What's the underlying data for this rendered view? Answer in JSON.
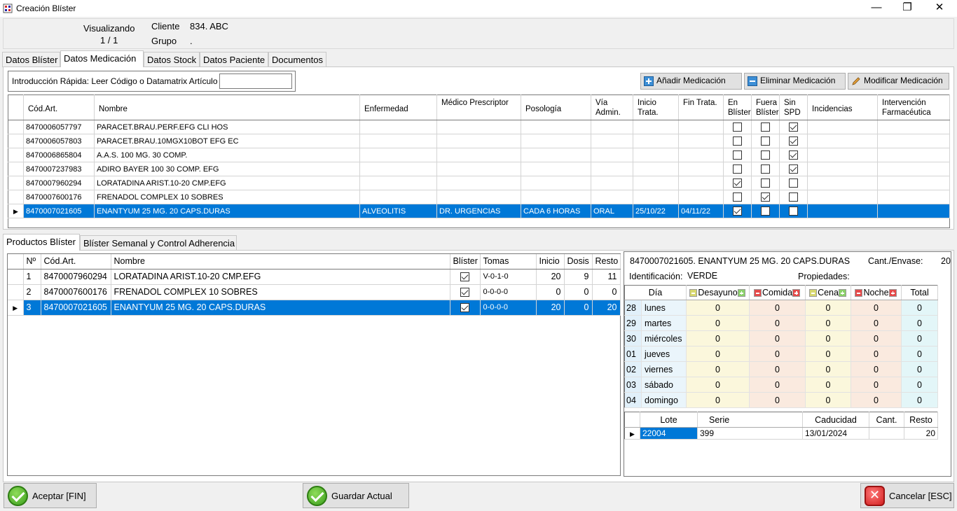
{
  "window": {
    "title": "Creación Blíster"
  },
  "header": {
    "visualizando_label": "Visualizando",
    "visualizando_value": "1 / 1",
    "cliente_label": "Cliente",
    "cliente_value": "834. ABC",
    "grupo_label": "Grupo",
    "grupo_value": "."
  },
  "tabs": [
    "Datos Blíster",
    "Datos Medicación",
    "Datos Stock",
    "Datos Paciente",
    "Documentos"
  ],
  "quick": {
    "label": "Introducción Rápida: Leer Código o Datamatrix Artículo",
    "value": ""
  },
  "buttons": {
    "add": "Añadir Medicación",
    "delete": "Eliminar Medicación",
    "modify": "Modificar Medicación"
  },
  "medgrid": {
    "columns": [
      "Cód.Art.",
      "Nombre",
      "Enfermedad",
      "Médico Prescriptor",
      "Posología",
      "Vía Admin.",
      "Inicio Trata.",
      "Fin Trata.",
      "En Blíster",
      "Fuera Blíster",
      "Sin SPD",
      "Incidencias",
      "Intervención Farmacéutica"
    ],
    "rows": [
      {
        "cod": "8470006057797",
        "nombre": "PARACET.BRAU.PERF.EFG CLI HOS",
        "enf": "",
        "med": "",
        "pos": "",
        "via": "",
        "ini": "",
        "fin": "",
        "en": false,
        "fuera": false,
        "sin": true
      },
      {
        "cod": "8470006057803",
        "nombre": "PARACET.BRAU.10MGX10BOT EFG EC",
        "enf": "",
        "med": "",
        "pos": "",
        "via": "",
        "ini": "",
        "fin": "",
        "en": false,
        "fuera": false,
        "sin": true
      },
      {
        "cod": "8470006865804",
        "nombre": "A.A.S. 100 MG. 30 COMP.",
        "enf": "",
        "med": "",
        "pos": "",
        "via": "",
        "ini": "",
        "fin": "",
        "en": false,
        "fuera": false,
        "sin": true
      },
      {
        "cod": "8470007237983",
        "nombre": "ADIRO BAYER 100 30 COMP. EFG",
        "enf": "",
        "med": "",
        "pos": "",
        "via": "",
        "ini": "",
        "fin": "",
        "en": false,
        "fuera": false,
        "sin": true
      },
      {
        "cod": "8470007960294",
        "nombre": "LORATADINA ARIST.10-20 CMP.EFG",
        "enf": "",
        "med": "",
        "pos": "",
        "via": "",
        "ini": "",
        "fin": "",
        "en": true,
        "fuera": false,
        "sin": false
      },
      {
        "cod": "8470007600176",
        "nombre": "FRENADOL COMPLEX 10 SOBRES",
        "enf": "",
        "med": "",
        "pos": "",
        "via": "",
        "ini": "",
        "fin": "",
        "en": false,
        "fuera": true,
        "sin": false
      },
      {
        "cod": "8470007021605",
        "nombre": "ENANTYUM  25 MG. 20 CAPS.DURAS",
        "enf": "ALVEOLITIS",
        "med": "DR. URGENCIAS",
        "pos": "CADA 6 HORAS",
        "via": "ORAL",
        "ini": "25/10/22",
        "fin": "04/11/22",
        "en": true,
        "fuera": false,
        "sin": false
      }
    ]
  },
  "bottom_tabs": [
    "Productos Blíster",
    "Blíster Semanal y Control Adherencia"
  ],
  "prodgrid": {
    "columns": [
      "Nº",
      "Cód.Art.",
      "Nombre",
      "Blíster",
      "Tomas",
      "Inicio",
      "Dosis",
      "Resto"
    ],
    "rows": [
      {
        "n": "1",
        "cod": "8470007960294",
        "nombre": "LORATADINA ARIST.10-20 CMP.EFG",
        "blister": true,
        "tomas": "V-0-1-0",
        "inicio": "20",
        "dosis": "9",
        "resto": "11"
      },
      {
        "n": "2",
        "cod": "8470007600176",
        "nombre": "FRENADOL COMPLEX 10 SOBRES",
        "blister": true,
        "tomas": "0-0-0-0",
        "inicio": "0",
        "dosis": "0",
        "resto": "0"
      },
      {
        "n": "3",
        "cod": "8470007021605",
        "nombre": "ENANTYUM  25 MG. 20 CAPS.DURAS",
        "blister": true,
        "tomas": "0-0-0-0",
        "inicio": "20",
        "dosis": "0",
        "resto": "20"
      }
    ]
  },
  "detail": {
    "product": "8470007021605. ENANTYUM  25 MG. 20 CAPS.DURAS",
    "cant_label": "Cant./Envase:",
    "cant_value": "20",
    "ident_label": "Identificación:",
    "ident_value": "VERDE",
    "props_label": "Propiedades:"
  },
  "schedule": {
    "columns": [
      "Día",
      "Desayuno",
      "Comida",
      "Cena",
      "Noche",
      "Total"
    ],
    "rows": [
      {
        "num": "28",
        "day": "lunes",
        "v": [
          "0",
          "0",
          "0",
          "0",
          "0"
        ]
      },
      {
        "num": "29",
        "day": "martes",
        "v": [
          "0",
          "0",
          "0",
          "0",
          "0"
        ]
      },
      {
        "num": "30",
        "day": "miércoles",
        "v": [
          "0",
          "0",
          "0",
          "0",
          "0"
        ]
      },
      {
        "num": "01",
        "day": "jueves",
        "v": [
          "0",
          "0",
          "0",
          "0",
          "0"
        ]
      },
      {
        "num": "02",
        "day": "viernes",
        "v": [
          "0",
          "0",
          "0",
          "0",
          "0"
        ]
      },
      {
        "num": "03",
        "day": "sábado",
        "v": [
          "0",
          "0",
          "0",
          "0",
          "0"
        ]
      },
      {
        "num": "04",
        "day": "domingo",
        "v": [
          "0",
          "0",
          "0",
          "0",
          "0"
        ]
      }
    ]
  },
  "lots": {
    "columns": [
      "Lote",
      "Serie",
      "Caducidad",
      "Cant.",
      "Resto"
    ],
    "rows": [
      {
        "lote": "22004",
        "serie": "399",
        "cad": "13/01/2024",
        "cant": "",
        "resto": "20"
      }
    ]
  },
  "footer": {
    "accept": "Aceptar [FIN]",
    "save": "Guardar Actual",
    "cancel": "Cancelar [ESC]"
  }
}
